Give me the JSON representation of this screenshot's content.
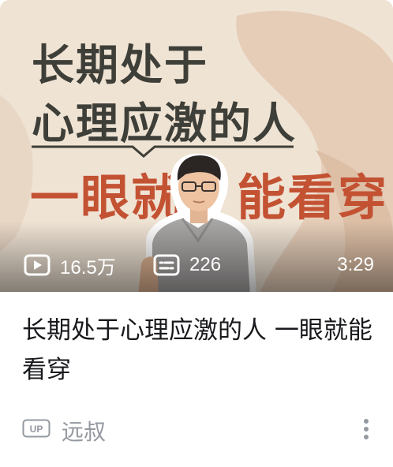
{
  "thumbnail": {
    "headline_line1": "长期处于",
    "headline_line2": "心理应激的人",
    "headline_line3a": "一眼就",
    "headline_line3b": "能看穿",
    "views": "16.5万",
    "danmaku": "226",
    "duration": "3:29",
    "icons": {
      "views": "play-count-icon",
      "danmaku": "danmaku-icon"
    }
  },
  "video": {
    "title": "长期处于心理应激的人 一眼就能看穿"
  },
  "author": {
    "badge": "UP",
    "name": "远叔"
  },
  "colors": {
    "headline_dark": "#3e3f38",
    "headline_accent": "#c35233",
    "background_beige": "#efe4d6",
    "meta_gray": "#9499a0",
    "title_text": "#18191c"
  }
}
